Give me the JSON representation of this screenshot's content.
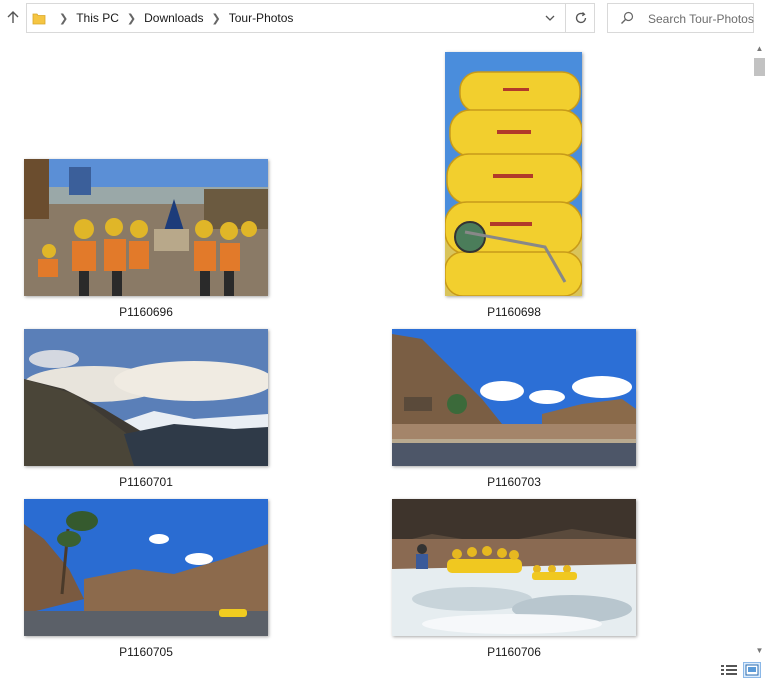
{
  "address": {
    "breadcrumbs": [
      "This PC",
      "Downloads",
      "Tour-Photos"
    ],
    "folder_icon": "folder-icon",
    "dropdown_icon": "chevron-down-icon",
    "refresh_icon": "refresh-icon"
  },
  "search": {
    "placeholder": "Search Tour-Photos",
    "icon": "search-icon"
  },
  "files": [
    {
      "name": "P1160696"
    },
    {
      "name": "P1160698"
    },
    {
      "name": "P1160701"
    },
    {
      "name": "P1160703"
    },
    {
      "name": "P1160705"
    },
    {
      "name": "P1160706"
    }
  ],
  "view_buttons": [
    "details-view-icon",
    "large-icons-view-icon"
  ],
  "colors": {
    "border": "#d9d9d9",
    "selected_view_bg": "#dcecfc",
    "folder_yellow": "#f5c542"
  }
}
